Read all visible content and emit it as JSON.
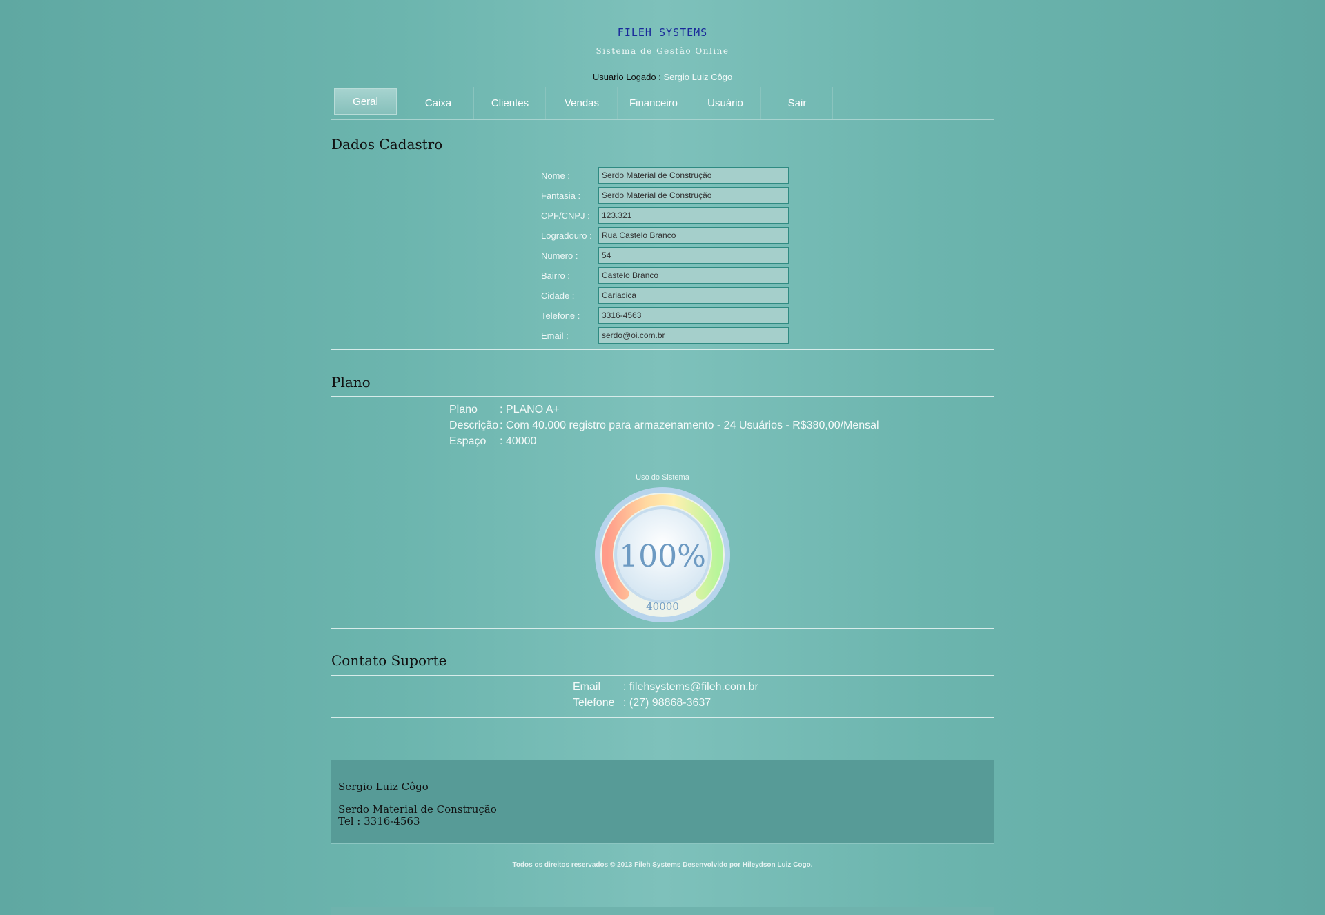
{
  "header": {
    "brand": "FILEH SYSTEMS",
    "subtitle": "Sistema de Gestão Online",
    "user_label": "Usuario Logado :",
    "user_name": "Sergio Luiz Côgo"
  },
  "nav": {
    "items": [
      {
        "label": "Geral",
        "active": true
      },
      {
        "label": "Caixa"
      },
      {
        "label": "Clientes"
      },
      {
        "label": "Vendas"
      },
      {
        "label": "Financeiro"
      },
      {
        "label": "Usuário"
      },
      {
        "label": "Sair"
      }
    ]
  },
  "dados": {
    "title": "Dados Cadastro",
    "fields": [
      {
        "label": "Nome :",
        "value": "Serdo Material de Construção"
      },
      {
        "label": "Fantasia :",
        "value": "Serdo Material de Construção"
      },
      {
        "label": "CPF/CNPJ :",
        "value": "123.321"
      },
      {
        "label": "Logradouro :",
        "value": "Rua Castelo Branco"
      },
      {
        "label": "Numero :",
        "value": "54"
      },
      {
        "label": "Bairro :",
        "value": "Castelo Branco"
      },
      {
        "label": "Cidade :",
        "value": "Cariacica"
      },
      {
        "label": "Telefone :",
        "value": "3316-4563"
      },
      {
        "label": "Email :",
        "value": "serdo@oi.com.br"
      }
    ]
  },
  "plano": {
    "title": "Plano",
    "rows": [
      {
        "key": "Plano",
        "value": ": PLANO A+"
      },
      {
        "key": "Descrição",
        "value": ": Com 40.000 registro para armazenamento - 24 Usuários - R$380,00/Mensal"
      },
      {
        "key": "Espaço",
        "value": ": 40000"
      }
    ]
  },
  "gauge": {
    "title": "Uso do Sistema",
    "percent_label": "100%",
    "capacity_label": "40000",
    "fill_fraction": 1.0
  },
  "suporte": {
    "title": "Contato Suporte",
    "rows": [
      {
        "key": "Email",
        "value": ": filehsystems@fileh.com.br"
      },
      {
        "key": "Telefone",
        "value": ": (27) 98868-3637"
      }
    ]
  },
  "footer": {
    "user": "Sergio Luiz Côgo",
    "company": "Serdo Material de Construção",
    "phone": "Tel : 3316-4563",
    "copyright": "Todos os direitos reservados © 2013 Fileh Systems Desenvolvido por Hileydson Luiz Cogo."
  }
}
